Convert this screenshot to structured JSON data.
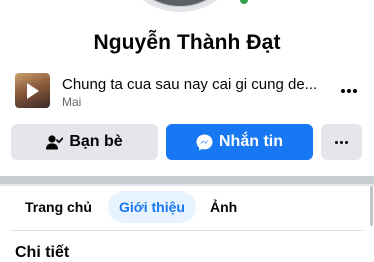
{
  "profile": {
    "name": "Nguyễn Thành Đạt",
    "online": true
  },
  "music": {
    "title": "Chung ta cua sau nay cai gi cung de...",
    "subtitle": "Mai",
    "thumbnail_icon": "play-icon",
    "more_icon": "more-horizontal-icon"
  },
  "actions": {
    "friends_label": "Bạn bè",
    "friends_icon": "friend-check-icon",
    "message_label": "Nhắn tin",
    "message_icon": "messenger-icon",
    "more_icon": "more-horizontal-icon"
  },
  "tabs": [
    {
      "label": "Trang chủ",
      "active": false
    },
    {
      "label": "Giới thiệu",
      "active": true
    },
    {
      "label": "Ảnh",
      "active": false
    }
  ],
  "section": {
    "heading": "Chi tiết"
  },
  "colors": {
    "accent": "#1877f2",
    "active_tab_bg": "#e7f3ff",
    "button_gray": "#e4e6eb",
    "online": "#31a24c"
  }
}
